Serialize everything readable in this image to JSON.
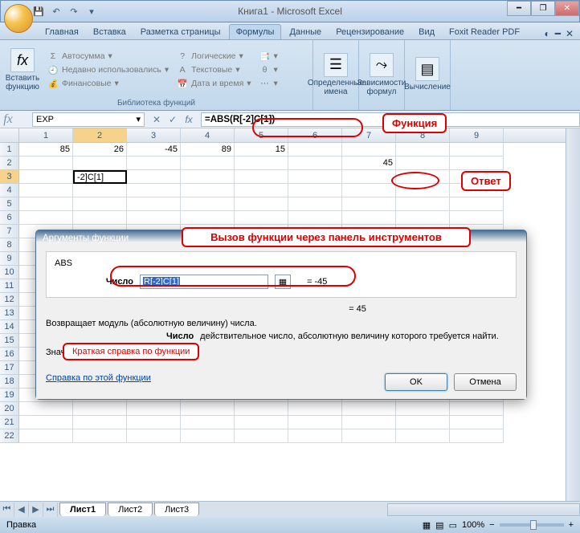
{
  "titlebar": {
    "title": "Книга1 - Microsoft Excel"
  },
  "ribbon_tabs": [
    "Главная",
    "Вставка",
    "Разметка страницы",
    "Формулы",
    "Данные",
    "Рецензирование",
    "Вид",
    "Foxit Reader PDF"
  ],
  "active_tab_index": 3,
  "ribbon": {
    "insert_fn": "Вставить функцию",
    "lib_label": "Библиотека функций",
    "autosum": "Автосумма",
    "recent": "Недавно использовались",
    "financial": "Финансовые",
    "logical": "Логические",
    "text": "Текстовые",
    "datetime": "Дата и время",
    "named": "Определенные имена",
    "depends": "Зависимости формул",
    "calc": "Вычисление"
  },
  "namebox": "EXP",
  "formula": "=ABS(R[-2]C[1])",
  "columns": [
    "1",
    "2",
    "3",
    "4",
    "5",
    "6",
    "7",
    "8",
    "9"
  ],
  "selected_col_index": 1,
  "rows": [
    "1",
    "2",
    "3",
    "4",
    "5",
    "6",
    "7",
    "8",
    "9",
    "10",
    "11",
    "12",
    "13",
    "14",
    "15",
    "16",
    "17",
    "18",
    "19",
    "20",
    "21",
    "22"
  ],
  "selected_row_index": 2,
  "cells": {
    "r1": [
      "85",
      "26",
      "-45",
      "89",
      "15",
      "",
      "",
      "",
      ""
    ],
    "r2_c7": "45",
    "r3_c2": "-2]C[1]"
  },
  "dialog": {
    "title": "Аргументы функции",
    "fn": "ABS",
    "arg_label": "Число",
    "arg_value": "R[-2]C[1]",
    "arg_eval": "-45",
    "result_eval": "45",
    "desc": "Возвращает модуль (абсолютную величину) числа.",
    "param_name": "Число",
    "param_desc": "действительное число, абсолютную величину которого требуется найти.",
    "result_label": "Значение:",
    "result_value": "45",
    "help_link": "Справка по этой функции",
    "ok": "OK",
    "cancel": "Отмена"
  },
  "sheet_tabs": [
    "Лист1",
    "Лист2",
    "Лист3"
  ],
  "status": {
    "mode": "Правка",
    "zoom": "100%"
  },
  "annotations": {
    "function": "Функция",
    "answer": "Ответ",
    "call": "Вызов функции через панель инструментов",
    "brief": "Краткая справка по функции"
  }
}
